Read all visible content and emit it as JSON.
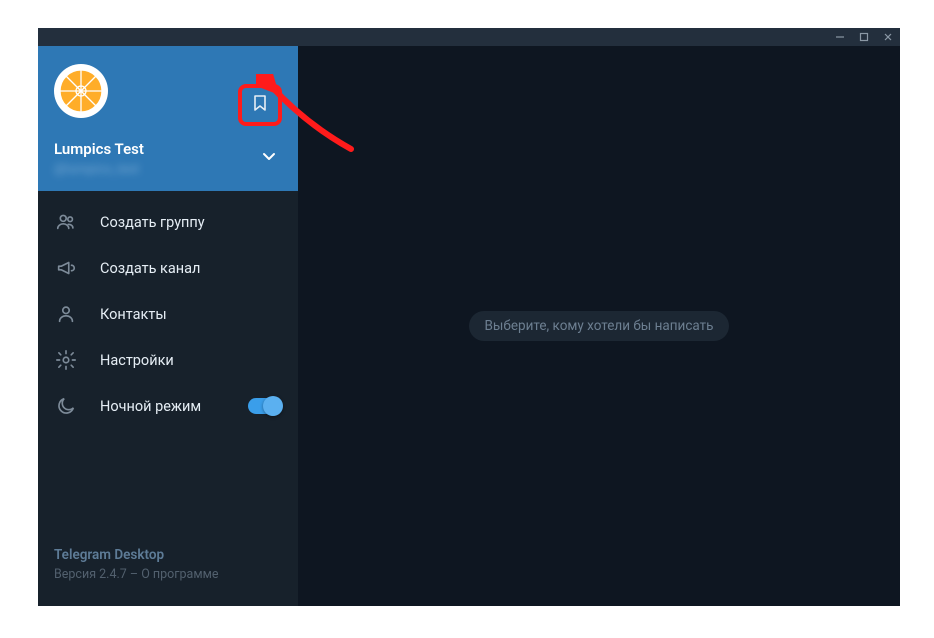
{
  "profile": {
    "username": "Lumpics Test",
    "handle": "@lumpics_test"
  },
  "menu": {
    "new_group": "Создать группу",
    "new_channel": "Создать канал",
    "contacts": "Контакты",
    "settings": "Настройки",
    "night_mode": "Ночной режим"
  },
  "footer": {
    "app_name": "Telegram Desktop",
    "version_line": "Версия 2.4.7 – О программе"
  },
  "main": {
    "placeholder": "Выберите, кому хотели бы написать"
  },
  "toggles": {
    "night_mode_on": true
  }
}
